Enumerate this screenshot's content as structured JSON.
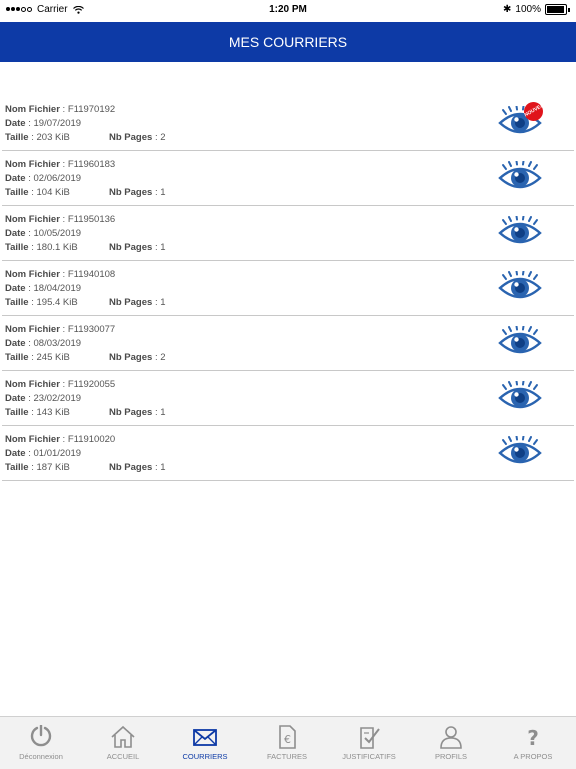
{
  "status_bar": {
    "carrier": "Carrier",
    "time": "1:20 PM",
    "battery": "100%"
  },
  "header": {
    "title": "MES COURRIERS"
  },
  "labels": {
    "file_name": "Nom Fichier",
    "date": "Date",
    "size": "Taille",
    "pages": "Nb Pages",
    "new_badge": "NOUVEAU"
  },
  "rows": [
    {
      "file": ": F11970192",
      "date": ": 19/07/2019",
      "size": ": 203 KiB",
      "pages": ": 2",
      "is_new": true
    },
    {
      "file": ": F11960183",
      "date": ": 02/06/2019",
      "size": ": 104 KiB",
      "pages": ": 1",
      "is_new": false
    },
    {
      "file": ": F11950136",
      "date": ": 10/05/2019",
      "size": ": 180.1 KiB",
      "pages": ": 1",
      "is_new": false
    },
    {
      "file": " :  F11940108",
      "date": ":  18/04/2019",
      "size": ": 195.4 KiB",
      "pages": ": 1",
      "is_new": false
    },
    {
      "file": " :  F11930077",
      "date": ": 08/03/2019",
      "size": ": 245 KiB",
      "pages": ": 2",
      "is_new": false
    },
    {
      "file": " :  F11920055",
      "date": ": 23/02/2019",
      "size": ": 143 KiB",
      "pages": ": 1",
      "is_new": false
    },
    {
      "file": " :  F11910020",
      "date": ": 01/01/2019",
      "size": ": 187 KiB",
      "pages": ": 1",
      "is_new": false
    }
  ],
  "tabs": [
    {
      "label": "Déconnexion",
      "icon": "power-icon",
      "active": false
    },
    {
      "label": "ACCUEIL",
      "icon": "home-icon",
      "active": false
    },
    {
      "label": "COURRIERS",
      "icon": "envelope-icon",
      "active": true
    },
    {
      "label": "FACTURES",
      "icon": "invoice-euro-icon",
      "active": false
    },
    {
      "label": "JUSTIFICATIFS",
      "icon": "document-check-icon",
      "active": false
    },
    {
      "label": "PROFILS",
      "icon": "person-icon",
      "active": false
    },
    {
      "label": "A PROPOS",
      "icon": "question-icon",
      "active": false
    }
  ],
  "colors": {
    "brand": "#0d3aa6",
    "eye": "#2a64b0",
    "badge": "#e0141b"
  }
}
